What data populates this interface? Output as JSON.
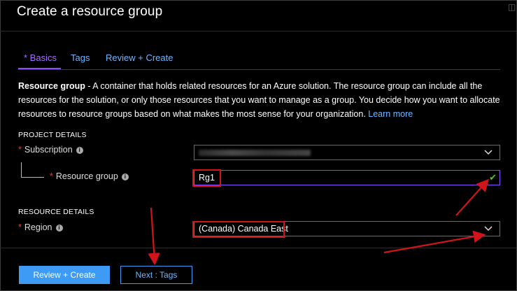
{
  "window": {
    "title": "Create a resource group"
  },
  "tabs": [
    {
      "required_marker": "* ",
      "label": "Basics",
      "active": true
    },
    {
      "label": "Tags",
      "active": false
    },
    {
      "label": "Review + Create",
      "active": false
    }
  ],
  "description": {
    "lead": "Resource group",
    "text": " - A container that holds related resources for an Azure solution. The resource group can include all the resources for the solution, or only those resources that you want to manage as a group. You decide how you want to allocate resources to resource groups based on what makes the most sense for your organization. ",
    "link": "Learn more"
  },
  "project_details": {
    "heading": "PROJECT DETAILS",
    "subscription": {
      "required_marker": "*",
      "label": "Subscription",
      "value_obscured": true
    },
    "resource_group": {
      "required_marker": "*",
      "label": "Resource group",
      "value": "Rg1",
      "valid_icon": "check-icon"
    }
  },
  "resource_details": {
    "heading": "RESOURCE DETAILS",
    "region": {
      "required_marker": "*",
      "label": "Region",
      "value": "(Canada) Canada East"
    }
  },
  "footer": {
    "primary_button": "Review + Create",
    "secondary_button": "Next : Tags"
  },
  "colors": {
    "accent_purple": "#8a4cff",
    "link_blue": "#6fb7ff",
    "primary_button": "#3d9bf5",
    "annotation_red": "#d0141a",
    "valid_green": "#57c12a"
  }
}
